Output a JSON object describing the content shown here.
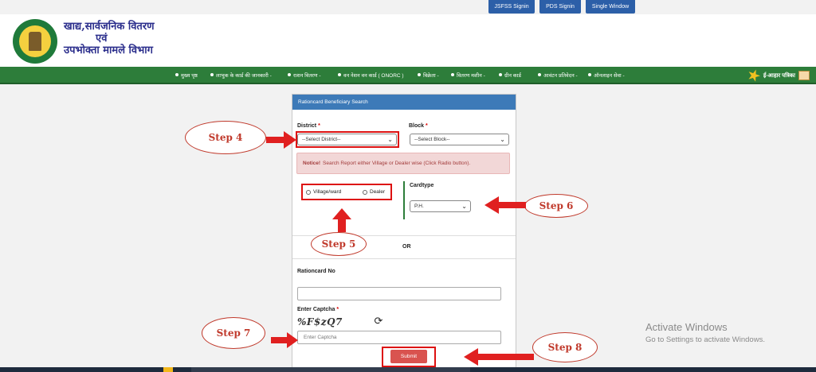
{
  "topbar": {
    "buttons": [
      "JSFSS Signin",
      "PDS Signin",
      "Single Window"
    ]
  },
  "header": {
    "logo_line1": "खाद्य,सार्वजनिक वितरण",
    "logo_line2": "एवं",
    "logo_line3": "उपभोक्ता मामले विभाग"
  },
  "nav": {
    "items": [
      "मुख्य पृष्ठ",
      "लाभुक के कार्ड की जानकारी -",
      "राशन वितरण -",
      "वन नेशन वन कार्ड ( ONORC )",
      "विक्रेता -",
      "वितरण मशीन -",
      "ग्रीन कार्ड",
      "आवंटन प्रतिवेदन -",
      "ऑनलाइन सेवा -"
    ],
    "eaahar_label": "ई-आहार पत्रिका"
  },
  "form": {
    "heading": "Rationcard Beneficiary Search",
    "district_label": "District",
    "district_value": "--Select District--",
    "block_label": "Block",
    "block_value": "--Select Block--",
    "required_mark": "*",
    "notice_title": "Notice!",
    "notice_text": "Search Report either Village or Dealer wise (Click Radio button).",
    "radio_village": "Village/ward",
    "radio_dealer": "Dealer",
    "cardtype_label": "Cardtype",
    "cardtype_value": "P.H.",
    "or_text": "OR",
    "rationcard_label": "Rationcard No",
    "rationcard_value": "",
    "captcha_label": "Enter Captcha",
    "captcha_image_text": "%F$zQ7",
    "captcha_placeholder": "Enter Captcha",
    "submit_label": "Submit"
  },
  "annotations": {
    "step4": "Step 4",
    "step5": "Step 5",
    "step6": "Step 6",
    "step7": "Step 7",
    "step8": "Step 8",
    "color": "#c0392b"
  },
  "watermark": {
    "line1": "Activate Windows",
    "line2": "Go to Settings to activate Windows."
  },
  "colors": {
    "nav_green": "#2d7d3a",
    "panel_blue": "#3d7ab8",
    "top_button_blue": "#2c5fa8",
    "submit_red": "#d9534f"
  }
}
